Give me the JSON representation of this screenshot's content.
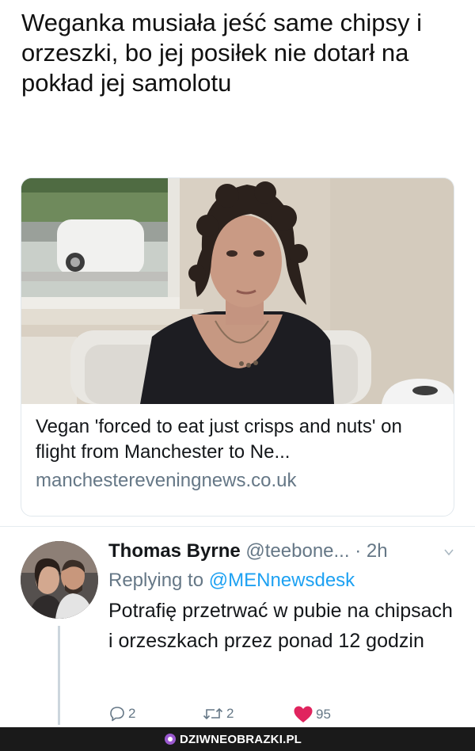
{
  "post": {
    "headline": "Weganka musiała jeść same chipsy i orzeszki, bo jej posiłek nie dotarł na pokład jej samolotu"
  },
  "link_card": {
    "title": "Vegan 'forced to eat just crisps and nuts' on flight from Manchester to Ne...",
    "domain": "manchestereveningnews.co.uk",
    "image": "photo of a woman with curly dark hair in a black top, seated in an armchair by a window"
  },
  "reply": {
    "author_name": "Thomas Byrne",
    "handle": "@teebone...",
    "time": "· 2h",
    "replying_prefix": "Replying to",
    "replying_to": "@MENnewsdesk",
    "text": "Potrafię przetrwać w pubie na chipsach i orzeszkach przez ponad 12 godzin",
    "replies_count": "2",
    "retweets_count": "2",
    "likes_count": "95",
    "like_color": "#e0245e"
  },
  "footer": {
    "watermark": "DZIWNEOBRAZKI.PL",
    "logo_color": "#9b59d0"
  }
}
